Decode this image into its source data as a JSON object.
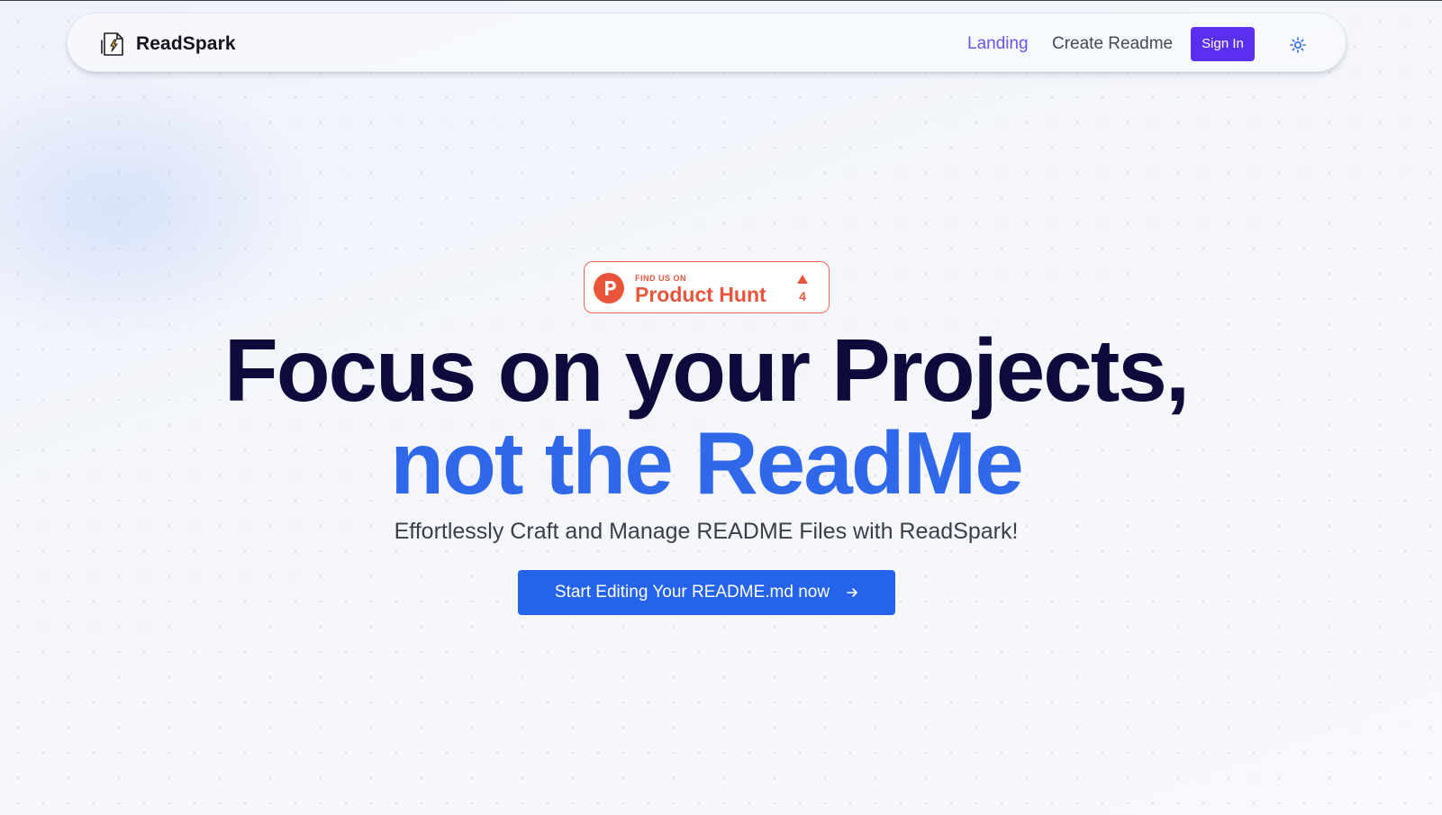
{
  "navbar": {
    "brand": "ReadSpark",
    "links": [
      {
        "label": "Landing"
      },
      {
        "label": "Create Readme"
      }
    ],
    "sign_in_label": "Sign In",
    "theme_toggle_icon": "sun-icon"
  },
  "product_hunt": {
    "small_text": "FIND US ON",
    "large_text": "Product Hunt",
    "upvotes": "4",
    "color": "#e8553b"
  },
  "hero": {
    "line1": "Focus on your Projects,",
    "line2": "not the ReadMe",
    "subtitle": "Effortlessly Craft and Manage README Files with ReadSpark!",
    "cta_label": "Start Editing Your README.md now",
    "cta_icon": "arrow-right-icon"
  },
  "colors": {
    "accent_purple": "#5a2ff0",
    "active_link": "#6a54ea",
    "heading_dark": "#0d0b3b",
    "heading_blue": "#2f69ea",
    "cta_blue": "#2563eb"
  }
}
